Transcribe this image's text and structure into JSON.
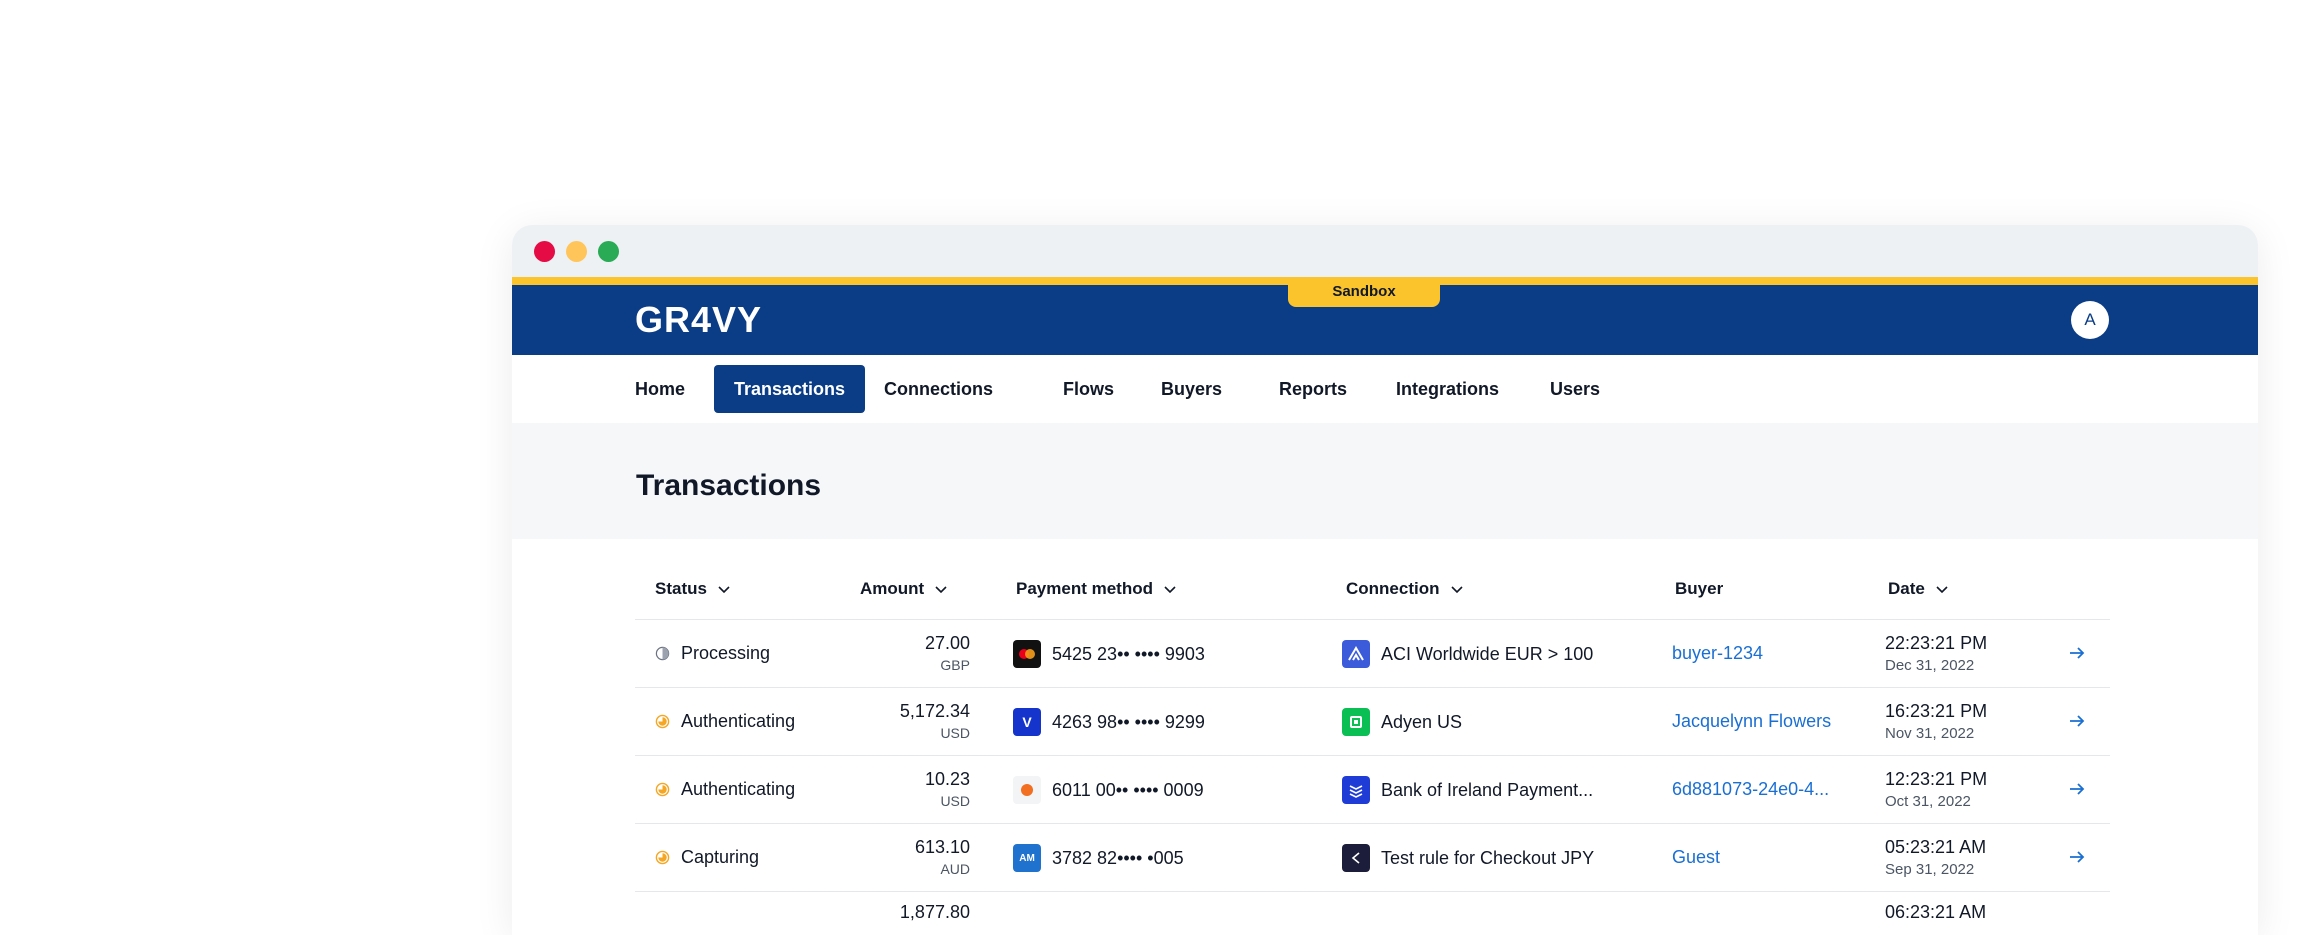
{
  "window": {
    "controls": [
      "close",
      "minimize",
      "maximize"
    ]
  },
  "appbar": {
    "logo": "GR4VY",
    "environment_badge": "Sandbox",
    "avatar_initial": "A"
  },
  "nav": {
    "items": [
      "Home",
      "Transactions",
      "Connections",
      "Flows",
      "Buyers",
      "Reports",
      "Integrations",
      "Users"
    ],
    "active": "Transactions"
  },
  "page": {
    "title": "Transactions"
  },
  "table": {
    "columns": [
      "Status",
      "Amount",
      "Payment method",
      "Connection",
      "Buyer",
      "Date"
    ],
    "rows": [
      {
        "status": "Processing",
        "status_icon": "half-circle-icon",
        "amount": "27.00",
        "currency": "GBP",
        "payment_method": "5425 23•• •••• 9903",
        "payment_icon": "mastercard-icon",
        "connection": "ACI Worldwide EUR > 100",
        "connection_icon": "aci-worldwide-icon",
        "buyer": "buyer-1234",
        "time": "22:23:21 PM",
        "date": "Dec 31, 2022"
      },
      {
        "status": "Authenticating",
        "status_icon": "pending-icon",
        "amount": "5,172.34",
        "currency": "USD",
        "payment_method": "4263 98•• •••• 9299",
        "payment_icon": "visa-icon",
        "connection": "Adyen US",
        "connection_icon": "adyen-icon",
        "buyer": "Jacquelynn Flowers",
        "time": "16:23:21 PM",
        "date": "Nov 31, 2022"
      },
      {
        "status": "Authenticating",
        "status_icon": "pending-icon",
        "amount": "10.23",
        "currency": "USD",
        "payment_method": "6011 00•• •••• 0009",
        "payment_icon": "discover-icon",
        "connection": "Bank of Ireland Payment...",
        "connection_icon": "bank-of-ireland-icon",
        "buyer": "6d881073-24e0-4...",
        "time": "12:23:21 PM",
        "date": "Oct 31, 2022"
      },
      {
        "status": "Capturing",
        "status_icon": "pending-icon",
        "amount": "613.10",
        "currency": "AUD",
        "payment_method": "3782 82•••• •005",
        "payment_icon": "amex-icon",
        "connection": "Test rule for Checkout JPY",
        "connection_icon": "checkout-icon",
        "buyer": "Guest",
        "time": "05:23:21 AM",
        "date": "Sep 31, 2022"
      }
    ],
    "partial_row": {
      "amount": "1,877.80",
      "time": "06:23:21 AM"
    }
  },
  "colors": {
    "brand": "#0b3d86",
    "sandbox": "#fcc42c",
    "link": "#1a6fd3",
    "pending": "#f5a623"
  }
}
